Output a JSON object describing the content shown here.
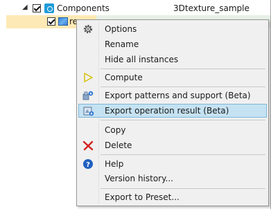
{
  "tree": {
    "root": {
      "label": "Components",
      "column2": "3Dtexture_sample",
      "expanded": true,
      "checked": true
    },
    "child": {
      "label": "re",
      "checked": true
    }
  },
  "menu": {
    "items": [
      {
        "label": "Options",
        "icon": "gear-icon"
      },
      {
        "label": "Rename",
        "icon": ""
      },
      {
        "label": "Hide all instances",
        "icon": ""
      },
      {
        "label": "Compute",
        "icon": "play-icon"
      },
      {
        "label": "Export patterns and support  (Beta)",
        "icon": "export-patterns-icon"
      },
      {
        "label": "Export operation result (Beta)",
        "icon": "export-result-icon",
        "highlighted": true
      },
      {
        "label": "Copy",
        "icon": ""
      },
      {
        "label": "Delete",
        "icon": "delete-icon"
      },
      {
        "label": "Help",
        "icon": "help-icon"
      },
      {
        "label": "Version history...",
        "icon": ""
      },
      {
        "label": "Export to Preset...",
        "icon": ""
      }
    ]
  },
  "colors": {
    "menu_bg": "#f0f0f0",
    "highlight_bg": "#c5e2f2",
    "highlight_border": "#7fb7d9",
    "selected_row": "#fde9b5",
    "component_icon": "#1f9bd8",
    "play_icon": "#d8c51c",
    "delete_icon": "#d32020",
    "help_icon": "#1f5fbf"
  }
}
